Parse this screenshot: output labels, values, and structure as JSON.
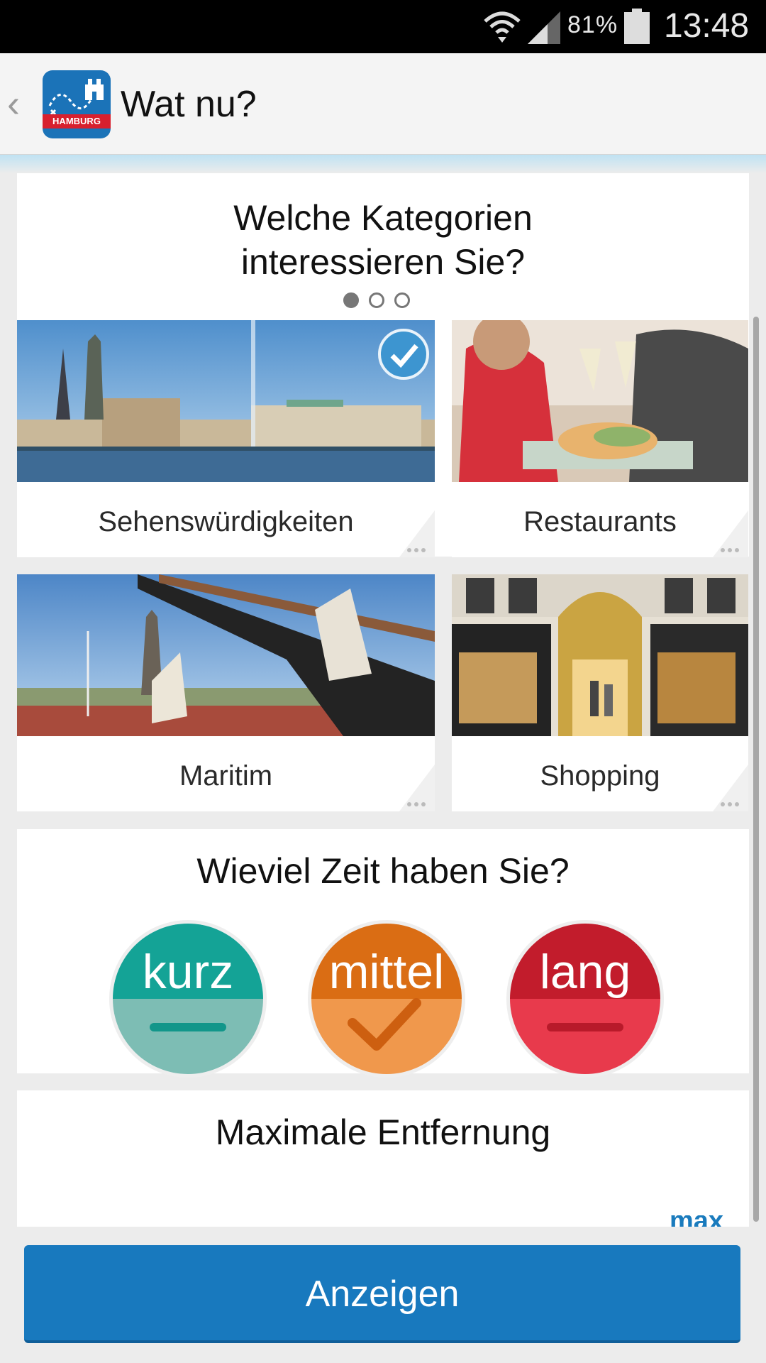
{
  "status_bar": {
    "battery_percent": "81%",
    "time": "13:48",
    "icons": [
      "wifi-icon",
      "signal-icon",
      "battery-icon"
    ]
  },
  "action_bar": {
    "back_icon": "chevron-left-icon",
    "logo_text": "HAMBURG",
    "title": "Wat nu?"
  },
  "categories_section": {
    "title_line1": "Welche Kategorien",
    "title_line2": "interessieren Sie?",
    "page_indicator": {
      "current": 1,
      "total": 3
    },
    "tiles": [
      {
        "label": "Sehenswürdigkeiten",
        "selected": true
      },
      {
        "label": "Restaurants",
        "selected": false
      },
      {
        "label": "Maritim",
        "selected": false
      },
      {
        "label": "Shopping",
        "selected": false
      }
    ]
  },
  "time_section": {
    "title": "Wieviel Zeit haben Sie?",
    "options": [
      {
        "label": "kurz",
        "selected": false,
        "color_top": "#14a396",
        "color_bottom": "#7dbdb4"
      },
      {
        "label": "mittel",
        "selected": true,
        "color_top": "#da6d14",
        "color_bottom": "#f0984c"
      },
      {
        "label": "lang",
        "selected": false,
        "color_top": "#c21c2c",
        "color_bottom": "#e83a4c"
      }
    ]
  },
  "distance_section": {
    "title": "Maximale Entfernung",
    "partial_label": "max"
  },
  "footer": {
    "show_button": "Anzeigen"
  },
  "colors": {
    "accent": "#1879be",
    "checkmark": "#3d95d0"
  }
}
